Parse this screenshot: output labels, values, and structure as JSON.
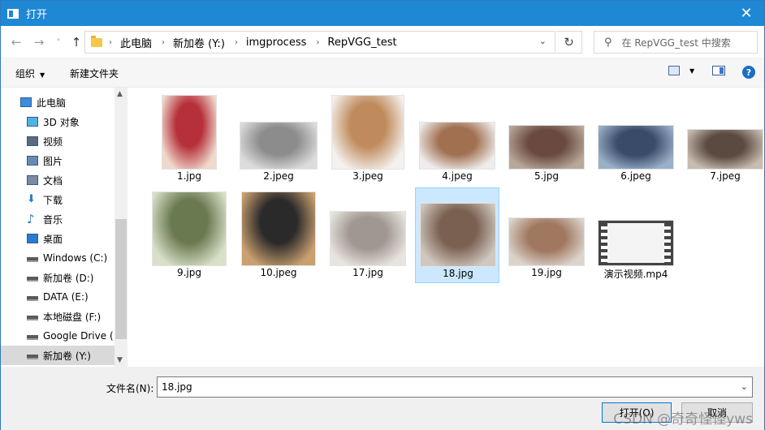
{
  "window": {
    "title": "打开",
    "close_glyph": "✕"
  },
  "nav": {
    "back_glyph": "←",
    "forward_glyph": "→",
    "recent_glyph": "˅",
    "up_glyph": "↑",
    "breadcrumbs": [
      "此电脑",
      "新加卷 (Y:)",
      "imgprocess",
      "RepVGG_test"
    ],
    "refresh_glyph": "↻",
    "search_placeholder": "在 RepVGG_test 中搜索"
  },
  "toolbar": {
    "organize": "组织",
    "new_folder": "新建文件夹"
  },
  "sidebar": {
    "items": [
      {
        "label": "此电脑",
        "icon": "computer-icon"
      },
      {
        "label": "3D 对象",
        "icon": "3d-objects-icon"
      },
      {
        "label": "视频",
        "icon": "video-folder-icon"
      },
      {
        "label": "图片",
        "icon": "pictures-folder-icon"
      },
      {
        "label": "文档",
        "icon": "documents-folder-icon"
      },
      {
        "label": "下载",
        "icon": "download-icon"
      },
      {
        "label": "音乐",
        "icon": "music-icon"
      },
      {
        "label": "桌面",
        "icon": "desktop-icon"
      },
      {
        "label": "Windows (C:)",
        "icon": "drive-icon"
      },
      {
        "label": "新加卷 (D:)",
        "icon": "drive-icon"
      },
      {
        "label": "DATA (E:)",
        "icon": "drive-icon"
      },
      {
        "label": "本地磁盘 (F:)",
        "icon": "drive-icon"
      },
      {
        "label": "Google Drive (",
        "icon": "drive-icon"
      },
      {
        "label": "新加卷 (Y:)",
        "icon": "drive-icon",
        "selected": true
      }
    ]
  },
  "files": [
    {
      "name": "1.jpg",
      "color": "#b5303a",
      "color2": "#f0d8cc"
    },
    {
      "name": "2.jpeg",
      "color": "#8c8c8c",
      "color2": "#dcdcdc"
    },
    {
      "name": "3.jpeg",
      "color": "#c08b5c",
      "color2": "#f4f1ee"
    },
    {
      "name": "4.jpeg",
      "color": "#a07050",
      "color2": "#efeceb"
    },
    {
      "name": "5.jpg",
      "color": "#6a4a40",
      "color2": "#b8a89a"
    },
    {
      "name": "6.jpeg",
      "color": "#3a4a6a",
      "color2": "#9ab0c8"
    },
    {
      "name": "7.jpeg",
      "color": "#5a4a40",
      "color2": "#c8bcb0"
    },
    {
      "name": "9.jpg",
      "color": "#6a7a50",
      "color2": "#d8e0c8"
    },
    {
      "name": "10.jpeg",
      "color": "#2a2a2a",
      "color2": "#caa070"
    },
    {
      "name": "17.jpg",
      "color": "#a09890",
      "color2": "#e8e4e0"
    },
    {
      "name": "18.jpg",
      "color": "#7a6050",
      "color2": "#d0c8c0",
      "selected": true
    },
    {
      "name": "19.jpg",
      "color": "#a07860",
      "color2": "#dcd4cc"
    },
    {
      "name": "演示视频.mp4",
      "color": "#444444",
      "color2": "#f4f4f4"
    }
  ],
  "footer": {
    "filename_label": "文件名(N):",
    "filename_value": "18.jpg",
    "open_button": "打开(O)",
    "cancel_button": "取消",
    "watermark": "CSDN @奇奇怪怪yws"
  }
}
